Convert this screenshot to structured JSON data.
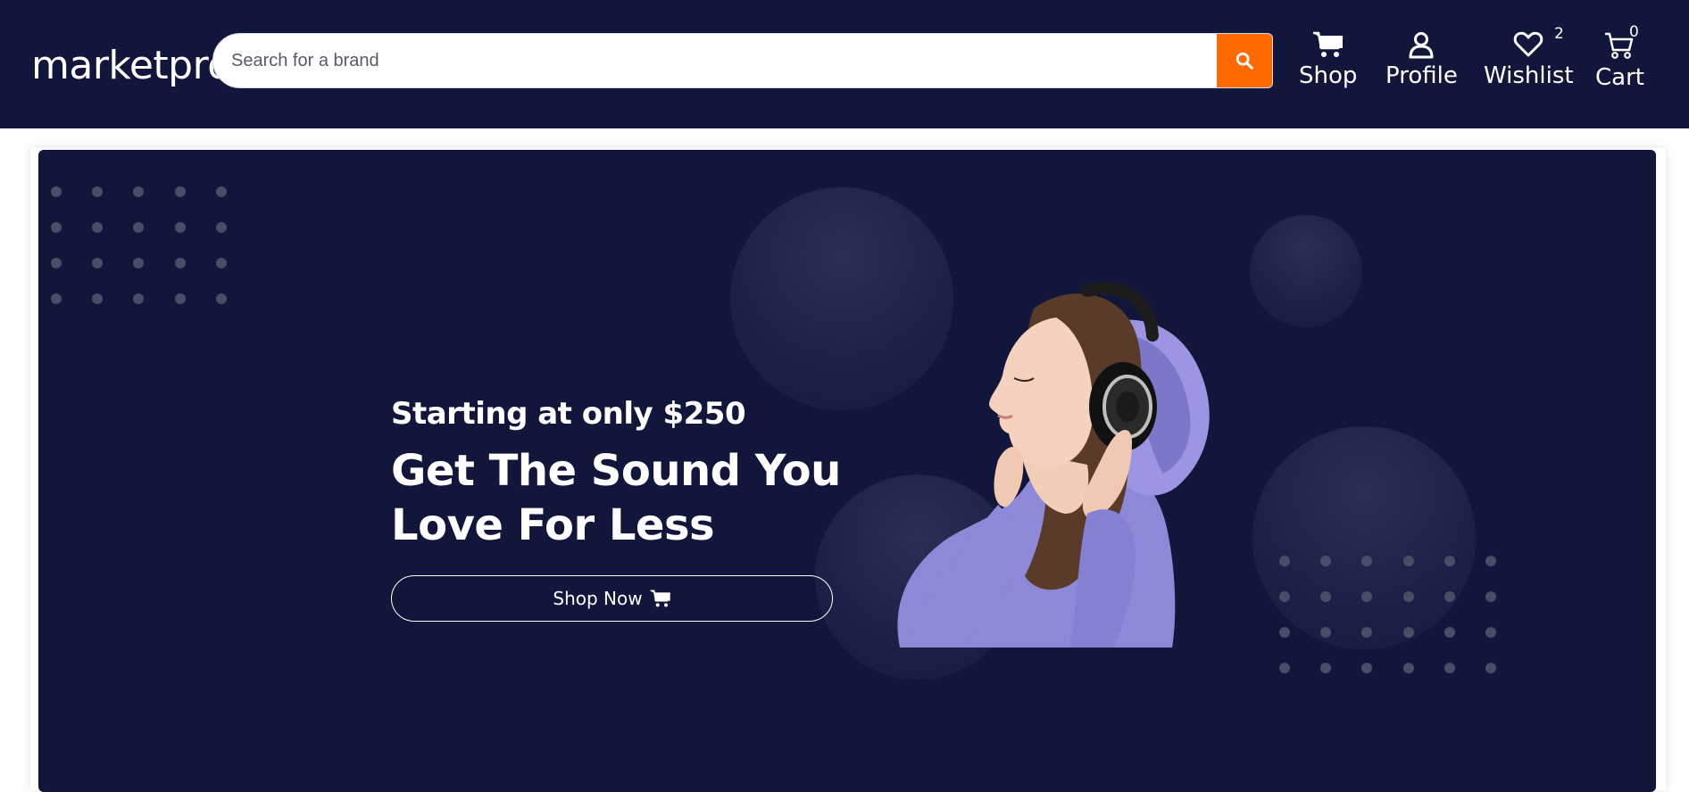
{
  "header": {
    "logo": "marketpro",
    "search": {
      "placeholder": "Search for a brand",
      "value": ""
    },
    "nav": {
      "shop": "Shop",
      "profile": "Profile",
      "wishlist": "Wishlist",
      "wishlist_count": "2",
      "cart": "Cart",
      "cart_count": "0"
    },
    "icons": {
      "search": "search-icon",
      "shop": "shopping-cart-icon",
      "profile": "user-icon",
      "wishlist": "heart-icon",
      "cart": "cart-outline-icon"
    }
  },
  "hero": {
    "subtitle": "Starting at only $250",
    "title": "Get The Sound You Love For Less",
    "button_label": "Shop Now",
    "button_icon": "shopping-cart-icon",
    "image": "woman-with-headphones-illustration"
  },
  "colors": {
    "background": "#13163b",
    "accent": "#ff6a00",
    "text": "#ffffff",
    "hoodie": "#8e88d8"
  }
}
